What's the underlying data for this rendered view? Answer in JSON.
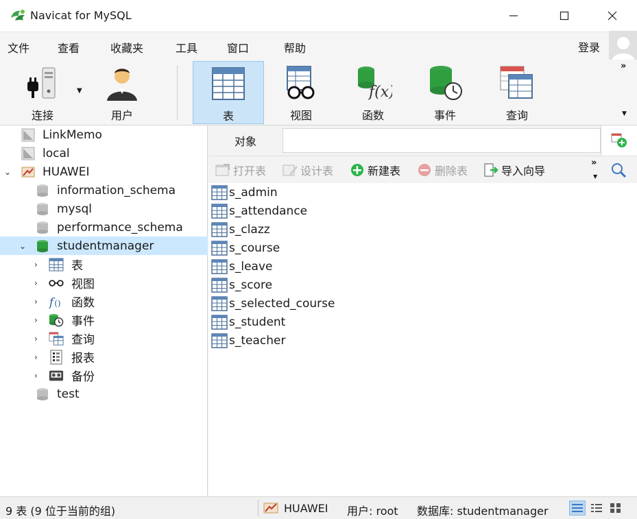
{
  "window": {
    "title": "Navicat for MySQL",
    "minimize_glyph": "—",
    "maximize_glyph": "☐",
    "close_glyph": "✕"
  },
  "menu": {
    "items": [
      "文件",
      "查看",
      "收藏夹",
      "工具",
      "窗口",
      "帮助"
    ],
    "login": "登录"
  },
  "toolbar": {
    "tools": [
      {
        "label": "连接",
        "icon": "connection-icon"
      },
      {
        "label": "用户",
        "icon": "user-icon"
      },
      {
        "label": "表",
        "icon": "table-icon",
        "active": true
      },
      {
        "label": "视图",
        "icon": "view-icon"
      },
      {
        "label": "函数",
        "icon": "function-icon"
      },
      {
        "label": "事件",
        "icon": "event-icon"
      },
      {
        "label": "查询",
        "icon": "query-icon"
      }
    ],
    "more": "»"
  },
  "sidebar": {
    "connections": [
      {
        "label": "LinkMemo",
        "type": "connection-closed"
      },
      {
        "label": "local",
        "type": "connection-closed"
      },
      {
        "label": "HUAWEI",
        "type": "connection-open",
        "expanded": true
      }
    ],
    "databases": [
      {
        "label": "information_schema"
      },
      {
        "label": "mysql"
      },
      {
        "label": "performance_schema"
      },
      {
        "label": "studentmanager",
        "selected": true,
        "expanded": true
      }
    ],
    "db_children": [
      {
        "label": "表",
        "icon": "table-icon"
      },
      {
        "label": "视图",
        "icon": "view-icon"
      },
      {
        "label": "函数",
        "icon": "function-icon"
      },
      {
        "label": "事件",
        "icon": "event-icon"
      },
      {
        "label": "查询",
        "icon": "query-icon"
      },
      {
        "label": "报表",
        "icon": "report-icon"
      },
      {
        "label": "备份",
        "icon": "backup-icon"
      }
    ],
    "last_db": {
      "label": "test"
    }
  },
  "objects": {
    "tab_label": "对象",
    "search_value": ""
  },
  "actions": {
    "open": "打开表",
    "design": "设计表",
    "new": "新建表",
    "delete": "删除表",
    "import": "导入向导",
    "more": "»"
  },
  "tables": [
    "s_admin",
    "s_attendance",
    "s_clazz",
    "s_course",
    "s_leave",
    "s_score",
    "s_selected_course",
    "s_student",
    "s_teacher"
  ],
  "status": {
    "count": "9 表 (9 位于当前的组)",
    "connection": "HUAWEI",
    "user": "用户: root",
    "database": "数据库: studentmanager"
  },
  "colors": {
    "accent_selected": "#cce8ff",
    "toolbar_active": "#cce4f7",
    "db_icon": "#2e9e3e",
    "add_green": "#2bb44a"
  }
}
